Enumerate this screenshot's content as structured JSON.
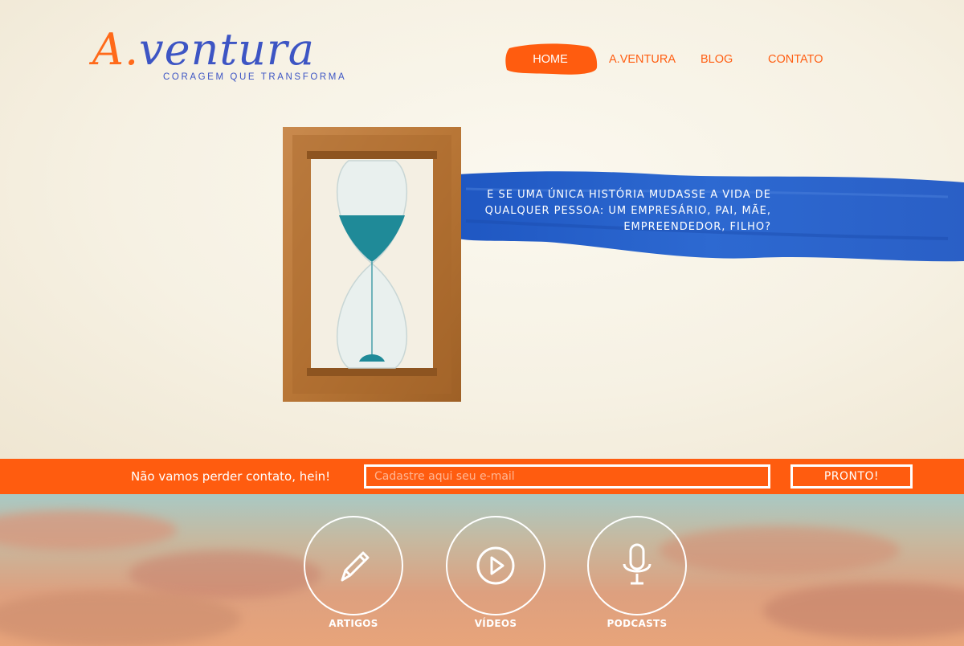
{
  "logo": {
    "script_part1": "A.",
    "script_part2": "ventura",
    "tagline": "CORAGEM QUE TRANSFORMA"
  },
  "nav": {
    "items": [
      {
        "label": "HOME",
        "active": true
      },
      {
        "label": "A.VENTURA",
        "active": false
      },
      {
        "label": "BLOG",
        "active": false
      },
      {
        "label": "CONTATO",
        "active": false
      }
    ]
  },
  "hero": {
    "ribbon_text": "E se uma única história mudasse a vida de qualquer pessoa: um empresário, pai, mãe, empreendedor, filho?"
  },
  "signup": {
    "label": "Não vamos perder contato, hein!",
    "input_value": "",
    "input_placeholder": "Cadastre aqui seu e-mail",
    "button_label": "PRONTO!"
  },
  "categories": [
    {
      "label": "ARTIGOS",
      "icon": "pencil-icon"
    },
    {
      "label": "VÍDEOS",
      "icon": "play-icon"
    },
    {
      "label": "PODCASTS",
      "icon": "microphone-icon"
    }
  ],
  "colors": {
    "accent_orange": "#ff5c0f",
    "brand_blue": "#3d55c4",
    "ribbon_blue": "#2a62c9"
  }
}
